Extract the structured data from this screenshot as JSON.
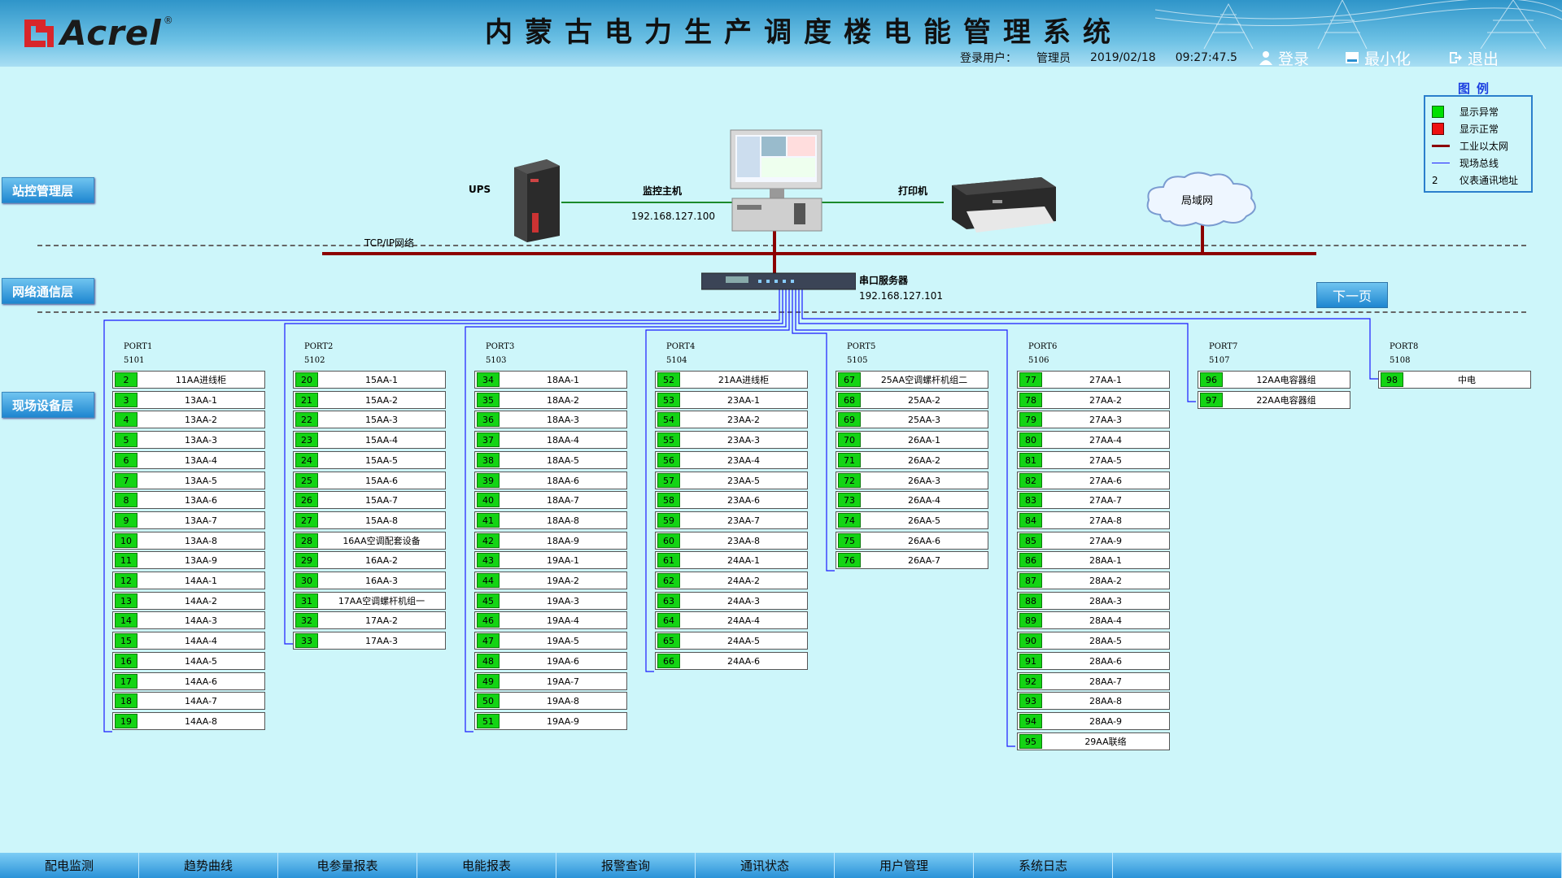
{
  "header": {
    "logo_text": "Acrel",
    "logo_reg": "®",
    "title": "内蒙古电力生产调度楼电能管理系统",
    "login_user_label": "登录用户：",
    "login_user": "管理员",
    "date": "2019/02/18",
    "time": "09:27:47.5",
    "login_btn": "登录",
    "minimize_btn": "最小化",
    "exit_btn": "退出"
  },
  "layers": {
    "station": "站控管理层",
    "network": "网络通信层",
    "field": "现场设备层"
  },
  "legend": {
    "title": "图例",
    "items": [
      {
        "label": "显示异常",
        "color": "#00e000"
      },
      {
        "label": "显示正常",
        "color": "#ee1111"
      },
      {
        "label": "工业以太网",
        "color": "#8b0000"
      },
      {
        "label": "现场总线",
        "color": "#1a1aff"
      },
      {
        "label": "仪表通讯地址",
        "symbol": "2"
      }
    ]
  },
  "network": {
    "ups_label": "UPS",
    "host_label": "监控主机",
    "host_ip": "192.168.127.100",
    "printer_label": "打印机",
    "lan_label": "局域网",
    "tcpip_label": "TCP/IP网络",
    "serial_label": "串口服务器",
    "serial_ip": "192.168.127.101",
    "next_btn": "下一页"
  },
  "ports": [
    {
      "name": "PORT1",
      "num": "5101",
      "devices": [
        [
          "2",
          "11AA进线柜"
        ],
        [
          "3",
          "13AA-1"
        ],
        [
          "4",
          "13AA-2"
        ],
        [
          "5",
          "13AA-3"
        ],
        [
          "6",
          "13AA-4"
        ],
        [
          "7",
          "13AA-5"
        ],
        [
          "8",
          "13AA-6"
        ],
        [
          "9",
          "13AA-7"
        ],
        [
          "10",
          "13AA-8"
        ],
        [
          "11",
          "13AA-9"
        ],
        [
          "12",
          "14AA-1"
        ],
        [
          "13",
          "14AA-2"
        ],
        [
          "14",
          "14AA-3"
        ],
        [
          "15",
          "14AA-4"
        ],
        [
          "16",
          "14AA-5"
        ],
        [
          "17",
          "14AA-6"
        ],
        [
          "18",
          "14AA-7"
        ],
        [
          "19",
          "14AA-8"
        ]
      ]
    },
    {
      "name": "PORT2",
      "num": "5102",
      "devices": [
        [
          "20",
          "15AA-1"
        ],
        [
          "21",
          "15AA-2"
        ],
        [
          "22",
          "15AA-3"
        ],
        [
          "23",
          "15AA-4"
        ],
        [
          "24",
          "15AA-5"
        ],
        [
          "25",
          "15AA-6"
        ],
        [
          "26",
          "15AA-7"
        ],
        [
          "27",
          "15AA-8"
        ],
        [
          "28",
          "16AA空调配套设备"
        ],
        [
          "29",
          "16AA-2"
        ],
        [
          "30",
          "16AA-3"
        ],
        [
          "31",
          "17AA空调螺杆机组一"
        ],
        [
          "32",
          "17AA-2"
        ],
        [
          "33",
          "17AA-3"
        ]
      ]
    },
    {
      "name": "PORT3",
      "num": "5103",
      "devices": [
        [
          "34",
          "18AA-1"
        ],
        [
          "35",
          "18AA-2"
        ],
        [
          "36",
          "18AA-3"
        ],
        [
          "37",
          "18AA-4"
        ],
        [
          "38",
          "18AA-5"
        ],
        [
          "39",
          "18AA-6"
        ],
        [
          "40",
          "18AA-7"
        ],
        [
          "41",
          "18AA-8"
        ],
        [
          "42",
          "18AA-9"
        ],
        [
          "43",
          "19AA-1"
        ],
        [
          "44",
          "19AA-2"
        ],
        [
          "45",
          "19AA-3"
        ],
        [
          "46",
          "19AA-4"
        ],
        [
          "47",
          "19AA-5"
        ],
        [
          "48",
          "19AA-6"
        ],
        [
          "49",
          "19AA-7"
        ],
        [
          "50",
          "19AA-8"
        ],
        [
          "51",
          "19AA-9"
        ]
      ]
    },
    {
      "name": "PORT4",
      "num": "5104",
      "devices": [
        [
          "52",
          "21AA进线柜"
        ],
        [
          "53",
          "23AA-1"
        ],
        [
          "54",
          "23AA-2"
        ],
        [
          "55",
          "23AA-3"
        ],
        [
          "56",
          "23AA-4"
        ],
        [
          "57",
          "23AA-5"
        ],
        [
          "58",
          "23AA-6"
        ],
        [
          "59",
          "23AA-7"
        ],
        [
          "60",
          "23AA-8"
        ],
        [
          "61",
          "24AA-1"
        ],
        [
          "62",
          "24AA-2"
        ],
        [
          "63",
          "24AA-3"
        ],
        [
          "64",
          "24AA-4"
        ],
        [
          "65",
          "24AA-5"
        ],
        [
          "66",
          "24AA-6"
        ]
      ]
    },
    {
      "name": "PORT5",
      "num": "5105",
      "devices": [
        [
          "67",
          "25AA空调螺杆机组二"
        ],
        [
          "68",
          "25AA-2"
        ],
        [
          "69",
          "25AA-3"
        ],
        [
          "70",
          "26AA-1"
        ],
        [
          "71",
          "26AA-2"
        ],
        [
          "72",
          "26AA-3"
        ],
        [
          "73",
          "26AA-4"
        ],
        [
          "74",
          "26AA-5"
        ],
        [
          "75",
          "26AA-6"
        ],
        [
          "76",
          "26AA-7"
        ]
      ]
    },
    {
      "name": "PORT6",
      "num": "5106",
      "devices": [
        [
          "77",
          "27AA-1"
        ],
        [
          "78",
          "27AA-2"
        ],
        [
          "79",
          "27AA-3"
        ],
        [
          "80",
          "27AA-4"
        ],
        [
          "81",
          "27AA-5"
        ],
        [
          "82",
          "27AA-6"
        ],
        [
          "83",
          "27AA-7"
        ],
        [
          "84",
          "27AA-8"
        ],
        [
          "85",
          "27AA-9"
        ],
        [
          "86",
          "28AA-1"
        ],
        [
          "87",
          "28AA-2"
        ],
        [
          "88",
          "28AA-3"
        ],
        [
          "89",
          "28AA-4"
        ],
        [
          "90",
          "28AA-5"
        ],
        [
          "91",
          "28AA-6"
        ],
        [
          "92",
          "28AA-7"
        ],
        [
          "93",
          "28AA-8"
        ],
        [
          "94",
          "28AA-9"
        ],
        [
          "95",
          "29AA联络"
        ]
      ]
    },
    {
      "name": "PORT7",
      "num": "5107",
      "devices": [
        [
          "96",
          "12AA电容器组"
        ],
        [
          "97",
          "22AA电容器组"
        ]
      ]
    },
    {
      "name": "PORT8",
      "num": "5108",
      "devices": [
        [
          "98",
          "中电"
        ]
      ]
    }
  ],
  "nav": [
    "配电监测",
    "趋势曲线",
    "电参量报表",
    "电能报表",
    "报警查询",
    "通讯状态",
    "用户管理",
    "系统日志"
  ]
}
